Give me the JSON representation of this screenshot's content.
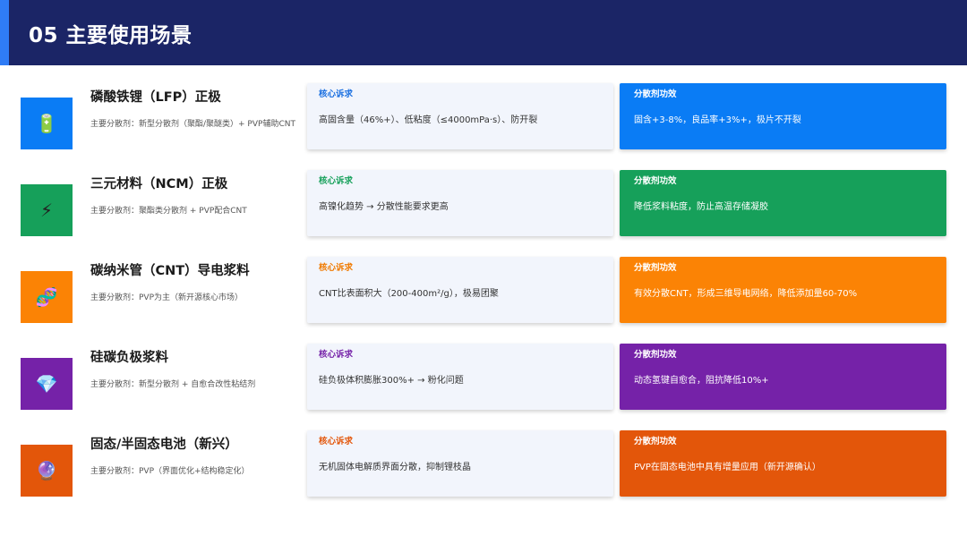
{
  "header": {
    "title": "05 主要使用场景"
  },
  "labels": {
    "need": "核心诉求",
    "effect": "分散剂功效"
  },
  "colors": {
    "header_bg": "#1b2566",
    "header_accent": "#2f7cf6",
    "blue": "#0a7cf5",
    "green": "#16a05a",
    "orange": "#fb8305",
    "purple": "#7522a8",
    "red": "#e3560a"
  },
  "scenes": [
    {
      "title": "磷酸铁锂（LFP）正极",
      "subtitle": "主要分散剂：新型分散剂（聚酯/聚醚类）+ PVP辅助CNT",
      "icon": "battery-icon",
      "icon_glyph": "🔋",
      "need": "高固含量（46%+）、低粘度（≤4000mPa·s）、防开裂",
      "effect": "固含+3-8%，良品率+3%+，极片不开裂"
    },
    {
      "title": "三元材料（NCM）正极",
      "subtitle": "主要分散剂：聚酯类分散剂 + PVP配合CNT",
      "icon": "lightning-icon",
      "icon_glyph": "⚡",
      "need": "高镍化趋势 → 分散性能要求更高",
      "effect": "降低浆料粘度，防止高温存储凝胶"
    },
    {
      "title": "碳纳米管（CNT）导电浆料",
      "subtitle": "主要分散剂：PVP为主（新开源核心市场）",
      "icon": "dna-icon",
      "icon_glyph": "🧬",
      "need": "CNT比表面积大（200-400m²/g），极易团聚",
      "effect": "有效分散CNT，形成三维导电网络，降低添加量60-70%"
    },
    {
      "title": "硅碳负极浆料",
      "subtitle": "主要分散剂：新型分散剂 + 自愈合改性粘结剂",
      "icon": "diamond-icon",
      "icon_glyph": "💎",
      "need": "硅负极体积膨胀300%+ → 粉化问题",
      "effect": "动态氢键自愈合，阻抗降低10%+"
    },
    {
      "title": "固态/半固态电池（新兴）",
      "subtitle": "主要分散剂：PVP（界面优化+结构稳定化）",
      "icon": "crystal-ball-icon",
      "icon_glyph": "🔮",
      "need": "无机固体电解质界面分散，抑制锂枝晶",
      "effect": "PVP在固态电池中具有增量应用（新开源确认）"
    }
  ]
}
